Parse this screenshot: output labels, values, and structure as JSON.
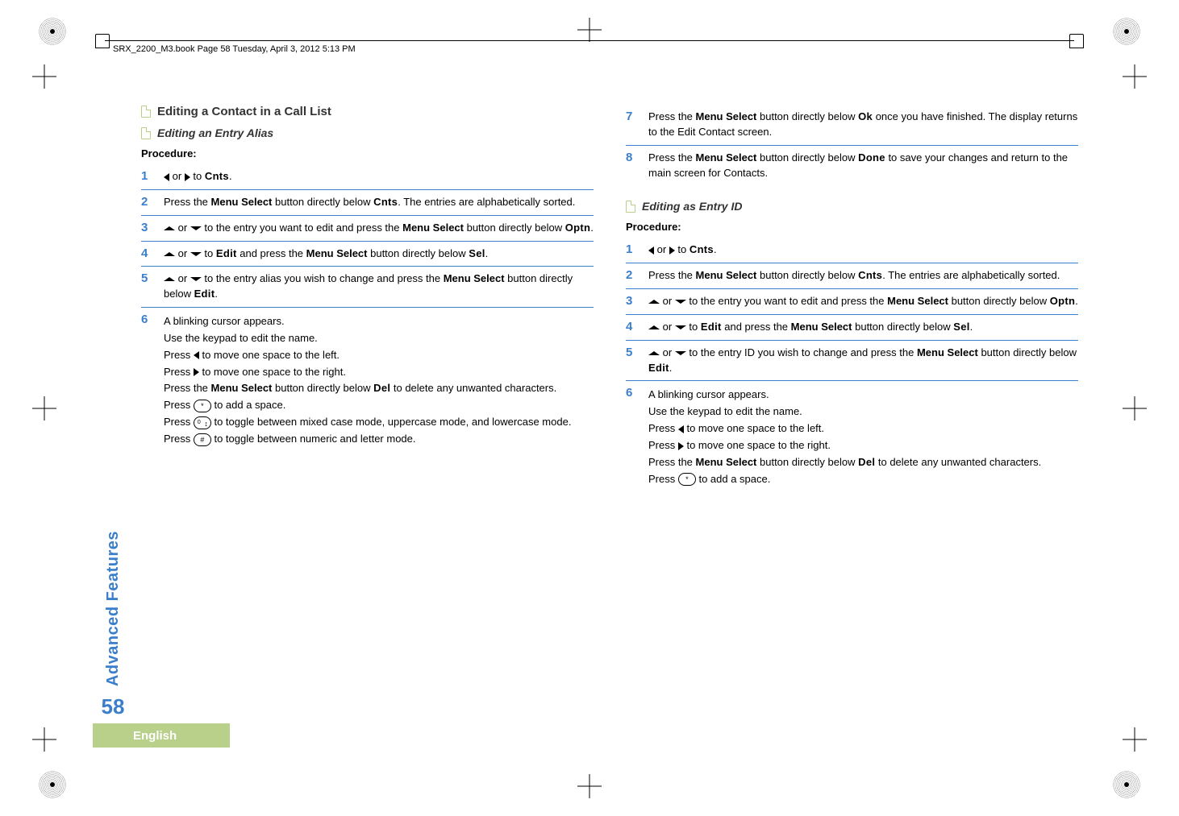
{
  "header": "SRX_2200_M3.book  Page 58  Tuesday, April 3, 2012  5:13 PM",
  "sidebar": {
    "title": "Advanced Features",
    "pageNum": "58"
  },
  "langTab": "English",
  "left": {
    "h2": "Editing a Contact in a Call List",
    "h3": "Editing an Entry Alias",
    "procLabel": "Procedure:",
    "s1a": " or ",
    "s1b": " to ",
    "s1c": "Cnts",
    "s1d": ".",
    "s2a": "Press the ",
    "s2b": "Menu Select",
    "s2c": " button directly below ",
    "s2d": "Cnts",
    "s2e": ". The entries are alphabetically sorted.",
    "s3a": " or ",
    "s3b": " to the entry you want to edit and press the ",
    "s3c": "Menu Select",
    "s3d": " button directly below ",
    "s3e": "Optn",
    "s3f": ".",
    "s4a": " or ",
    "s4b": " to ",
    "s4c": "Edit",
    "s4d": " and press the ",
    "s4e": "Menu Select",
    "s4f": " button directly below ",
    "s4g": "Sel",
    "s4h": ".",
    "s5a": " or ",
    "s5b": " to the entry alias you wish to change and press the ",
    "s5c": "Menu Select",
    "s5d": " button directly below ",
    "s5e": "Edit",
    "s5f": ".",
    "s6a": "A blinking cursor appears.",
    "s6b": "Use the keypad to edit the name.",
    "s6c1": "Press ",
    "s6c2": " to move one space to the left.",
    "s6d1": "Press ",
    "s6d2": " to move one space to the right.",
    "s6e1": "Press the ",
    "s6e2": "Menu Select",
    "s6e3": " button directly below ",
    "s6e4": "Del",
    "s6e5": " to delete any unwanted characters.",
    "s6f1": "Press ",
    "s6f2": " to add a space.",
    "s6g1": "Press ",
    "s6g2": " to toggle between mixed case mode, uppercase mode, and lowercase mode.",
    "s6h1": "Press ",
    "s6h2": " to toggle between numeric and letter mode.",
    "keyStar": "*",
    "keyHash": "#"
  },
  "right": {
    "s7a": "Press the ",
    "s7b": "Menu Select",
    "s7c": " button directly below ",
    "s7d": "Ok",
    "s7e": " once you have finished. The display returns to the Edit Contact screen.",
    "s8a": "Press the ",
    "s8b": "Menu Select",
    "s8c": " button directly below ",
    "s8d": "Done",
    "s8e": " to save your changes and return to the main screen for Contacts.",
    "h3": "Editing as Entry ID",
    "procLabel": "Procedure:",
    "s1a": " or ",
    "s1b": " to ",
    "s1c": "Cnts",
    "s1d": ".",
    "s2a": "Press the ",
    "s2b": "Menu Select",
    "s2c": " button directly below ",
    "s2d": "Cnts",
    "s2e": ". The entries are alphabetically sorted.",
    "s3a": " or ",
    "s3b": " to the entry you want to edit and press the ",
    "s3c": "Menu Select",
    "s3d": " button directly below ",
    "s3e": "Optn",
    "s3f": ".",
    "s4a": " or ",
    "s4b": " to ",
    "s4c": "Edit",
    "s4d": " and press the ",
    "s4e": "Menu Select",
    "s4f": " button directly below ",
    "s4g": "Sel",
    "s4h": ".",
    "s5a": " or ",
    "s5b": " to the entry ID you wish to change and press the ",
    "s5c": "Menu Select",
    "s5d": " button directly below ",
    "s5e": "Edit",
    "s5f": ".",
    "s6a": "A blinking cursor appears.",
    "s6b": "Use the keypad to edit the name.",
    "s6c1": "Press ",
    "s6c2": " to move one space to the left.",
    "s6d1": "Press ",
    "s6d2": " to move one space to the right.",
    "s6e1": "Press the ",
    "s6e2": "Menu Select",
    "s6e3": " button directly below ",
    "s6e4": "Del",
    "s6e5": " to delete any unwanted characters.",
    "s6f1": "Press ",
    "s6f2": " to add a space.",
    "keyStar": "*"
  },
  "nums": {
    "n1": "1",
    "n2": "2",
    "n3": "3",
    "n4": "4",
    "n5": "5",
    "n6": "6",
    "n7": "7",
    "n8": "8"
  }
}
